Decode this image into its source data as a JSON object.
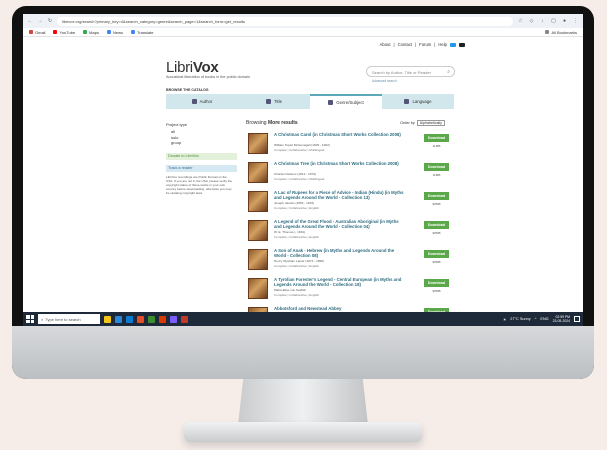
{
  "browser": {
    "url": "librivox.org/search?primary_key=4&search_category=genre&search_page=1&search_form=get_results",
    "bookmarks": [
      {
        "label": "Gmail",
        "color": "#d44638"
      },
      {
        "label": "YouTube",
        "color": "#ff0000"
      },
      {
        "label": "Maps",
        "color": "#34a853"
      },
      {
        "label": "News",
        "color": "#4285f4"
      },
      {
        "label": "Translate",
        "color": "#4285f4"
      }
    ],
    "all_bookmarks": "All Bookmarks"
  },
  "topnav": {
    "about": "About",
    "contact": "Contact",
    "forum": "Forum",
    "help": "Help",
    "sep": "|"
  },
  "logo": {
    "part1": "Libri",
    "part2": "Vox",
    "tagline": "Acoustical liberation of books in the public domain"
  },
  "search": {
    "placeholder": "Search by Author, Title or Reader",
    "advanced": "Advanced search"
  },
  "browse": {
    "label": "BROWSE THE CATALOG",
    "tabs": [
      {
        "label": "Author",
        "icon": "person-icon"
      },
      {
        "label": "Title",
        "icon": "book-icon"
      },
      {
        "label": "Genre/Subject",
        "icon": "shelf-icon"
      },
      {
        "label": "Language",
        "icon": "flag-icon"
      }
    ],
    "active_tab": 2
  },
  "sidebar": {
    "header": "Project type",
    "options": [
      "all",
      "solo",
      "group"
    ],
    "donate": "Donate to LibriVox",
    "volunteer": "Track a reader",
    "note": "LibriVox recordings are Public Domain in the USA. If you are not in the USA, please verify the copyright status of these works in your own country before downloading, otherwise you may be violating copyright laws."
  },
  "results": {
    "prefix": "Browsing",
    "bold": "More results",
    "order_label": "Order by",
    "order_value": "Alphabetically",
    "items": [
      {
        "title": "A Christmas Carol (in Christmas Short Works Collection 2008)",
        "author": "William Topaz McGonagall (1825 - 1902)",
        "meta": "Complete | Collaborative | Multilingual",
        "download": "Download",
        "size": "11MB"
      },
      {
        "title": "A Christmas Tree (in Christmas Short Works Collection 2008)",
        "author": "Charles Dickens (1812 - 1870)",
        "meta": "Complete | Collaborative | Multilingual",
        "download": "Download",
        "size": "11MB"
      },
      {
        "title": "A Lac of Rupees for a Piece of Advice - Indian (Hindu) (in Myths and Legends Around the World - Collection 13)",
        "author": "Joseph Jacobs (1854 - 1916)",
        "meta": "Complete | Collaborative | English",
        "download": "Download",
        "size": "98MB"
      },
      {
        "title": "A Legend of the Great Flood - Australian Aboriginal (in Myths and Legends Around the World - Collection 04)",
        "author": "W. E. Thomas (- 1934)",
        "meta": "Complete | Collaborative | English",
        "download": "Download",
        "size": "98MB"
      },
      {
        "title": "A Son of Anak - Hebrew (in Myths and Legends Around the World - Collection 08)",
        "author": "Henry Wysham Lanier (1873 - 1958)",
        "meta": "Complete | Collaborative | English",
        "download": "Download",
        "size": "98MB"
      },
      {
        "title": "A Tyrolian Forester's Legend - Central European (in Myths and Legends Around the World - Collection 18)",
        "author": "Maria Elise von Seidlitz",
        "meta": "Complete | Collaborative | English",
        "download": "Download",
        "size": "98MB"
      },
      {
        "title": "Abbotsford and Newstead Abbey",
        "author": "",
        "meta": "",
        "download": "Download",
        "size": ""
      }
    ]
  },
  "taskbar": {
    "search_placeholder": "Type here to search",
    "weather": "27°C Sunny",
    "lang": "ENG",
    "time": "02:59 PM",
    "date": "23-05-2024",
    "apps": [
      "#f5c518",
      "#2b88d8",
      "#0a7cd4",
      "#e44d26",
      "#3c8d2f",
      "#d83b01",
      "#7a5cff",
      "#c0392b"
    ]
  }
}
